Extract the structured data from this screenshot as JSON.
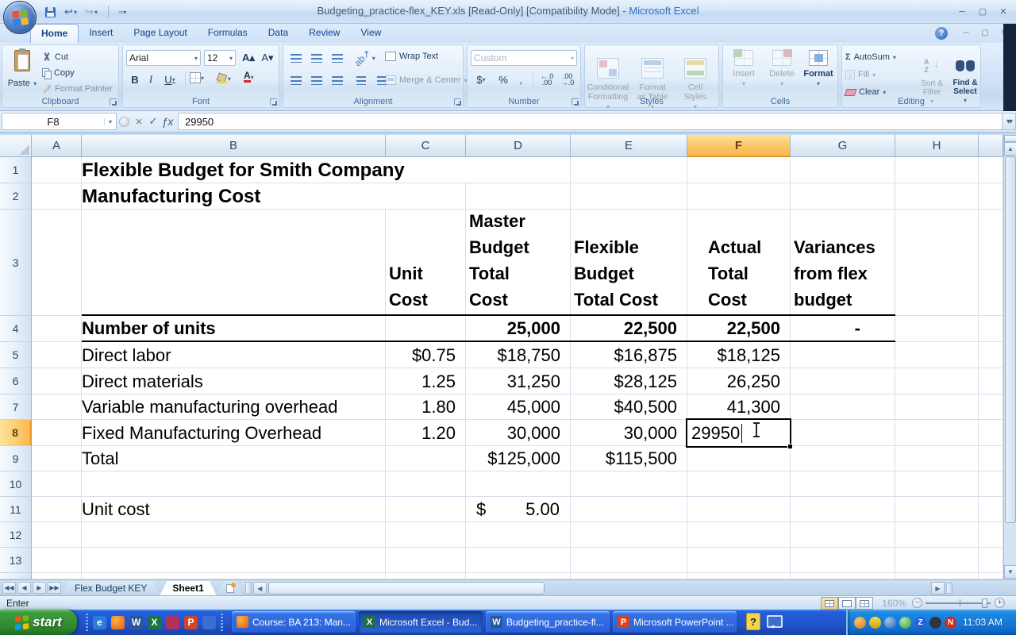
{
  "window": {
    "title_file": "Budgeting_practice-flex_KEY.xls  [Read-Only]  [Compatibility Mode] -",
    "title_app": "Microsoft Excel"
  },
  "ribbon": {
    "tabs": [
      "Home",
      "Insert",
      "Page Layout",
      "Formulas",
      "Data",
      "Review",
      "View"
    ],
    "active_tab": "Home",
    "clipboard": {
      "label": "Clipboard",
      "paste": "Paste",
      "cut": "Cut",
      "copy": "Copy",
      "format_painter": "Format Painter"
    },
    "font": {
      "label": "Font",
      "font_name": "Arial",
      "font_size": "12"
    },
    "alignment": {
      "label": "Alignment",
      "wrap_text": "Wrap Text",
      "merge_center": "Merge & Center"
    },
    "number": {
      "label": "Number",
      "format": "Custom"
    },
    "styles": {
      "label": "Styles",
      "conditional": "Conditional\nFormatting",
      "format_table": "Format\nas Table",
      "cell_styles": "Cell\nStyles"
    },
    "cells": {
      "label": "Cells",
      "insert": "Insert",
      "delete": "Delete",
      "format": "Format"
    },
    "editing": {
      "label": "Editing",
      "autosum": "AutoSum",
      "fill": "Fill",
      "clear": "Clear",
      "sort": "Sort &\nFilter",
      "find": "Find &\nSelect"
    }
  },
  "formula_bar": {
    "name_box": "F8",
    "value": "29950"
  },
  "sheet": {
    "columns": [
      "A",
      "B",
      "C",
      "D",
      "E",
      "F",
      "G",
      "H"
    ],
    "rows": [
      "1",
      "2",
      "3",
      "4",
      "5",
      "6",
      "7",
      "8",
      "9",
      "10",
      "11",
      "12",
      "13"
    ],
    "selected_column": "F",
    "selected_row": "8",
    "active_cell": "F8",
    "cells": [
      {
        "r": 1,
        "c": "B",
        "text": "Flexible Budget for Smith Company",
        "bold": true,
        "title": true
      },
      {
        "r": 2,
        "c": "B",
        "text": "Manufacturing Cost",
        "bold": true,
        "title": true
      },
      {
        "r": 3,
        "c": "B",
        "text": "",
        "bb": true
      },
      {
        "r": 3,
        "c": "C",
        "text": "Unit\nCost",
        "bold": true,
        "wrap": true,
        "bb": true
      },
      {
        "r": 3,
        "c": "D",
        "text": "Master\nBudget\nTotal\nCost",
        "bold": true,
        "wrap": true,
        "bb": true
      },
      {
        "r": 3,
        "c": "E",
        "text": "Flexible\nBudget\nTotal Cost",
        "bold": true,
        "wrap": true,
        "bb": true
      },
      {
        "r": 3,
        "c": "F",
        "text": "Actual\nTotal\nCost",
        "bold": true,
        "wrap": true,
        "bb": true,
        "padl": 26
      },
      {
        "r": 3,
        "c": "G",
        "text": "Variances\nfrom flex\nbudget",
        "bold": true,
        "wrap": true,
        "bb": true
      },
      {
        "r": 4,
        "c": "B",
        "text": "Number of units",
        "bold": true,
        "bb": true
      },
      {
        "r": 4,
        "c": "C",
        "text": "",
        "bb": true
      },
      {
        "r": 4,
        "c": "D",
        "text": "25,000",
        "bold": true,
        "num": true,
        "bb": true
      },
      {
        "r": 4,
        "c": "E",
        "text": "22,500",
        "bold": true,
        "num": true,
        "bb": true
      },
      {
        "r": 4,
        "c": "F",
        "text": "22,500",
        "bold": true,
        "num": true,
        "bb": true
      },
      {
        "r": 4,
        "c": "G",
        "text": "-",
        "bold": true,
        "num": true,
        "bb": true,
        "padr": 44
      },
      {
        "r": 5,
        "c": "B",
        "text": "Direct labor"
      },
      {
        "r": 5,
        "c": "C",
        "text": "$0.75",
        "num": true
      },
      {
        "r": 5,
        "c": "D",
        "text": "$18,750",
        "num": true
      },
      {
        "r": 5,
        "c": "E",
        "text": "$16,875",
        "num": true
      },
      {
        "r": 5,
        "c": "F",
        "text": "$18,125",
        "num": true
      },
      {
        "r": 6,
        "c": "B",
        "text": "Direct materials"
      },
      {
        "r": 6,
        "c": "C",
        "text": "1.25",
        "num": true
      },
      {
        "r": 6,
        "c": "D",
        "text": "31,250",
        "num": true
      },
      {
        "r": 6,
        "c": "E",
        "text": "$28,125",
        "num": true
      },
      {
        "r": 6,
        "c": "F",
        "text": "26,250",
        "num": true
      },
      {
        "r": 7,
        "c": "B",
        "text": "Variable manufacturing overhead"
      },
      {
        "r": 7,
        "c": "C",
        "text": "1.80",
        "num": true
      },
      {
        "r": 7,
        "c": "D",
        "text": "45,000",
        "num": true
      },
      {
        "r": 7,
        "c": "E",
        "text": "$40,500",
        "num": true
      },
      {
        "r": 7,
        "c": "F",
        "text": "41,300",
        "num": true
      },
      {
        "r": 8,
        "c": "B",
        "text": "Fixed Manufacturing Overhead"
      },
      {
        "r": 8,
        "c": "C",
        "text": "1.20",
        "num": true
      },
      {
        "r": 8,
        "c": "D",
        "text": "30,000",
        "num": true
      },
      {
        "r": 8,
        "c": "E",
        "text": "30,000",
        "num": true
      },
      {
        "r": 8,
        "c": "F",
        "text": "29950",
        "edit": true
      },
      {
        "r": 9,
        "c": "B",
        "text": "Total"
      },
      {
        "r": 9,
        "c": "D",
        "text": "$125,000",
        "num": true
      },
      {
        "r": 9,
        "c": "E",
        "text": "$115,500",
        "num": true
      },
      {
        "r": 11,
        "c": "B",
        "text": "Unit cost"
      },
      {
        "r": 11,
        "c": "D",
        "text": "5.00",
        "num": true,
        "currency": "$"
      }
    ]
  },
  "sheet_tabs": {
    "tabs": [
      {
        "label": "Flex Budget KEY",
        "active": false
      },
      {
        "label": "Sheet1",
        "active": true
      }
    ]
  },
  "status_bar": {
    "mode": "Enter",
    "zoom_level": "160%"
  },
  "taskbar": {
    "start_label": "start",
    "quick_launch": [
      "internet-explorer",
      "firefox",
      "word",
      "excel",
      "messenger",
      "powerpoint",
      "media"
    ],
    "buttons": [
      {
        "label": "Course: BA 213: Man...",
        "icon": "firefox",
        "pressed": false
      },
      {
        "label": "Microsoft Excel - Bud...",
        "icon": "excel",
        "pressed": true
      },
      {
        "label": "Budgeting_practice-fl...",
        "icon": "word",
        "pressed": false
      },
      {
        "label": "Microsoft PowerPoint ...",
        "icon": "powerpoint",
        "pressed": false
      }
    ],
    "tray_icons": [
      "globe",
      "shield",
      "key",
      "orb",
      "z-app",
      "dialer",
      "novell"
    ],
    "tray_time": "11:03 AM"
  },
  "icons": {
    "dropdown": "▾",
    "undo": "↩",
    "redo": "↪",
    "check": "✓",
    "cancel": "×",
    "insert_function": "ƒx",
    "sigma": "Σ",
    "dollar": "$",
    "percent": "%",
    "comma": ",",
    "nav_first": "◀",
    "nav_prev": "◀",
    "nav_next": "▶",
    "nav_last": "▶",
    "scroll_up": "▲",
    "scroll_down": "▼",
    "scroll_left": "◀",
    "scroll_right": "▶",
    "help": "?",
    "minimize": "─",
    "restore": "▢",
    "close": "×"
  }
}
